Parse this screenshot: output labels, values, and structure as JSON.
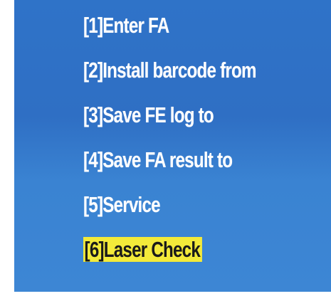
{
  "menu": {
    "items": [
      {
        "label": "[1]Enter FA",
        "selected": false
      },
      {
        "label": "[2]Install barcode from",
        "selected": false
      },
      {
        "label": "[3]Save FE log to",
        "selected": false
      },
      {
        "label": "[4]Save FA result to",
        "selected": false
      },
      {
        "label": "[5]Service",
        "selected": false
      },
      {
        "label": "[6]Laser Check",
        "selected": true
      }
    ]
  },
  "colors": {
    "screen_background": "#2f73c8",
    "text": "#ffffff",
    "selection_highlight": "#f3ea3a",
    "selection_text": "#1a1a1a"
  }
}
